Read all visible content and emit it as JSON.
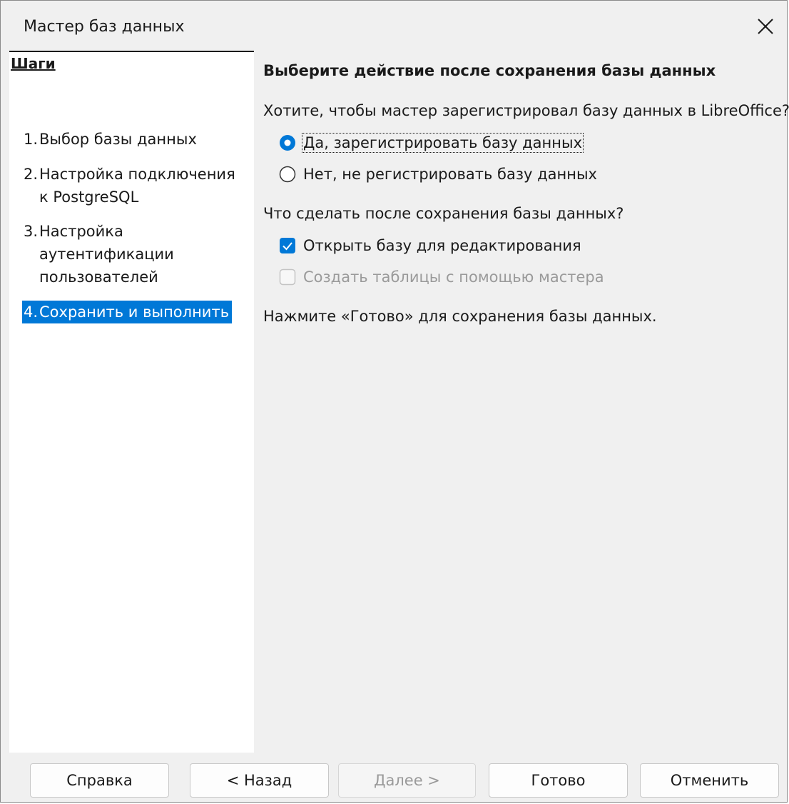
{
  "window": {
    "title": "Мастер баз данных"
  },
  "sidebar": {
    "header": "Шаги",
    "steps": [
      {
        "num": "1.",
        "label": "Выбор базы данных"
      },
      {
        "num": "2.",
        "label": "Настройка подключения к PostgreSQL"
      },
      {
        "num": "3.",
        "label": "Настройка аутентификации пользователей"
      },
      {
        "num": "4.",
        "label": "Сохранить и выполнить"
      }
    ],
    "active_step": 4
  },
  "content": {
    "heading": "Выберите действие после сохранения базы данных",
    "register_question": "Хотите, чтобы мастер зарегистрировал базу данных в LibreOffice?",
    "register_yes": "Да, зарегистрировать базу данных",
    "register_no": "Нет, не регистрировать базу данных",
    "register_selected": "yes",
    "after_question": "Что сделать после сохранения базы данных?",
    "open_for_edit": {
      "label": "Открыть базу для редактирования",
      "checked": true
    },
    "create_tables": {
      "label": "Создать таблицы с помощью мастера",
      "checked": false,
      "enabled": false
    },
    "finish_hint": "Нажмите «Готово» для сохранения базы данных."
  },
  "buttons": {
    "help": "Справка",
    "back": "< Назад",
    "next": "Далее >",
    "finish": "Готово",
    "cancel": "Отменить"
  },
  "colors": {
    "accent": "#0078d7",
    "dialog_bg": "#f0f0f0",
    "disabled_text": "#9a9a9a"
  },
  "icons": {
    "close": "close-icon"
  }
}
